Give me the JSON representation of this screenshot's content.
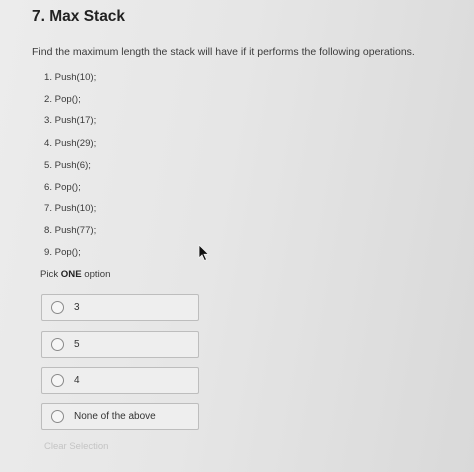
{
  "question": {
    "title": "7. Max Stack",
    "prompt": "Find the maximum length the stack will have if it performs the following operations."
  },
  "operations": [
    "1. Push(10);",
    "2. Pop();",
    "3. Push(17);",
    "4. Push(29);",
    "5. Push(6);",
    "6. Pop();",
    "7. Push(10);",
    "8. Push(77);",
    "9. Pop();"
  ],
  "pick": {
    "prefix": "Pick ",
    "emphasis": "ONE",
    "suffix": " option"
  },
  "options": [
    {
      "label": "3",
      "selected": false
    },
    {
      "label": "5",
      "selected": false
    },
    {
      "label": "4",
      "selected": false
    },
    {
      "label": "None of the above",
      "selected": false
    }
  ],
  "clear_selection": "Clear Selection"
}
